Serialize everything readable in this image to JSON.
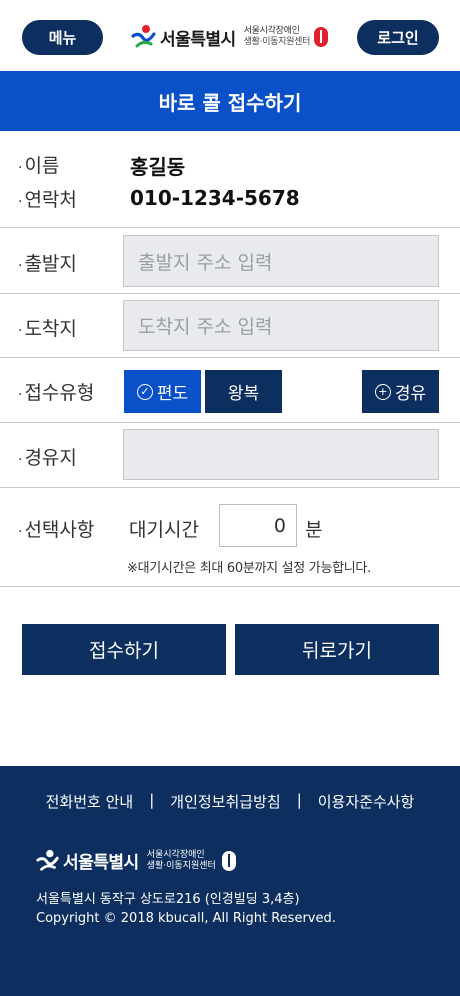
{
  "header": {
    "menu_label": "메뉴",
    "login_label": "로그인",
    "logo_city": "서울특별시",
    "logo_sub_line1": "서울시각장애인",
    "logo_sub_line2": "생활·이동지원센터"
  },
  "title": "바로 콜 접수하기",
  "info": {
    "name_label": "이름",
    "name_value": "홍길동",
    "contact_label": "연락처",
    "contact_value": "010-1234-5678"
  },
  "form": {
    "origin_label": "출발지",
    "origin_placeholder": "출발지 주소 입력",
    "dest_label": "도착지",
    "dest_placeholder": "도착지 주소 입력",
    "type_label": "접수유형",
    "type_options": [
      "편도",
      "왕복"
    ],
    "type_selected": "편도",
    "waypoint_button": "경유",
    "waypoint_label": "경유지",
    "waypoint_value": "",
    "option_label": "선택사항",
    "wait_label": "대기시간",
    "wait_value": "0",
    "wait_unit": "분",
    "wait_note": "※대기시간은 최대 60분까지 설정 가능합니다."
  },
  "actions": {
    "submit_label": "접수하기",
    "back_label": "뒤로가기"
  },
  "footer": {
    "links": [
      "전화번호 안내",
      "개인정보취급방침",
      "이용자준수사항"
    ],
    "separator": "|",
    "logo_city": "서울특별시",
    "logo_sub_line1": "서울시각장애인",
    "logo_sub_line2": "생활·이동지원센터",
    "address": "서울특별시 동작구 상도로216 (인경빌딩 3,4층)",
    "copyright": "Copyright © 2018 kbucall, All Right Reserved."
  },
  "colors": {
    "navy": "#0c2f5f",
    "blue": "#0a50c8",
    "field_bg": "#e8eaed"
  }
}
